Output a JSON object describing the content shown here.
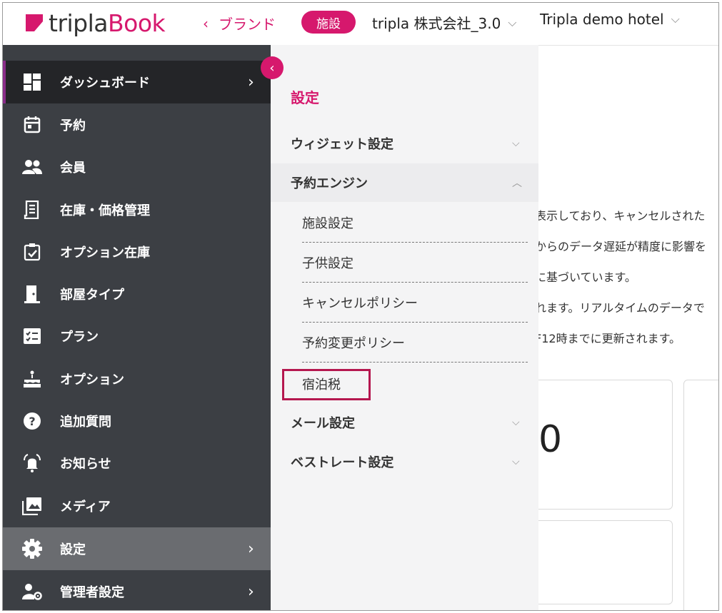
{
  "header": {
    "logo_text_a": "tripla",
    "logo_text_b": "Book",
    "back_label": "ブランド",
    "facility_badge": "施設",
    "company": "tripla 株式会社_3.0",
    "hotel": "Tripla demo hotel"
  },
  "sidebar": {
    "items": [
      {
        "label": "ダッシュボード",
        "icon": "dashboard-icon"
      },
      {
        "label": "予約",
        "icon": "calendar-icon"
      },
      {
        "label": "会員",
        "icon": "people-icon"
      },
      {
        "label": "在庫・価格管理",
        "icon": "receipt-icon"
      },
      {
        "label": "オプション在庫",
        "icon": "clipboard-check-icon"
      },
      {
        "label": "部屋タイプ",
        "icon": "door-icon"
      },
      {
        "label": "プラン",
        "icon": "checklist-icon"
      },
      {
        "label": "オプション",
        "icon": "cake-icon"
      },
      {
        "label": "追加質問",
        "icon": "help-icon"
      },
      {
        "label": "お知らせ",
        "icon": "bell-icon"
      },
      {
        "label": "メディア",
        "icon": "media-icon"
      },
      {
        "label": "設定",
        "icon": "gear-icon"
      },
      {
        "label": "管理者設定",
        "icon": "admin-icon"
      }
    ]
  },
  "submenu": {
    "title": "設定",
    "groups": {
      "widget": "ウィジェット設定",
      "engine": "予約エンジン",
      "mail": "メール設定",
      "bestrate": "ベストレート設定"
    },
    "engine_items": [
      "施設設定",
      "子供設定",
      "キャンセルポリシー",
      "予約変更ポリシー",
      "宿泊税"
    ]
  },
  "background": {
    "lines": [
      "表示しており、キャンセルされた",
      "からのデータ遅延が精度に影響を",
      "に基づいています。",
      "れます。リアルタイムのデータで",
      "F12時までに更新されます。"
    ],
    "big_number": "0"
  },
  "colors": {
    "accent": "#d6186d",
    "sidebar": "#3c3f44",
    "submenu": "#f4f4f5"
  }
}
